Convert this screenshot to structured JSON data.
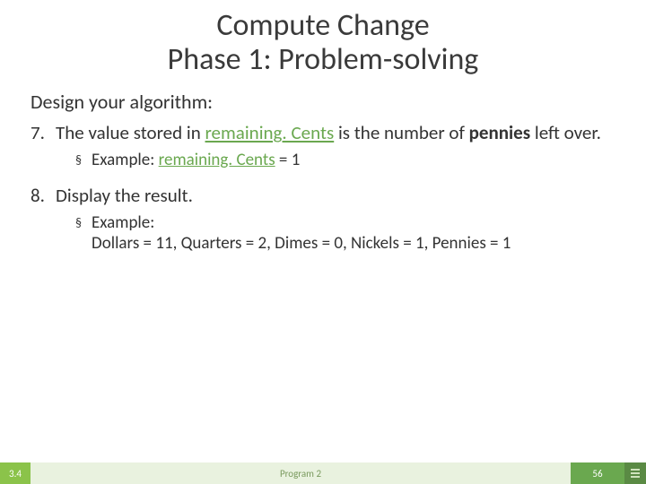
{
  "title": {
    "line1": "Compute Change",
    "line2": "Phase 1: Problem-solving"
  },
  "heading": "Design your algorithm:",
  "item7": {
    "num": "7.",
    "pre": "The value stored in ",
    "var": "remaining. Cents",
    "mid": " is the number of ",
    "bold": "pennies",
    "post": " left over."
  },
  "ex7": {
    "bullet": "§",
    "label": "Example: ",
    "var": "remaining. Cents",
    "val": " = 1"
  },
  "item8": {
    "num": "8.",
    "text": "Display the result."
  },
  "ex8": {
    "bullet": "§",
    "label": "Example:",
    "line": "Dollars = 11, Quarters = 2, Dimes = 0, Nickels = 1, Pennies = 1"
  },
  "footer": {
    "left": "3.4",
    "mid": "Program 2",
    "right": "56"
  }
}
